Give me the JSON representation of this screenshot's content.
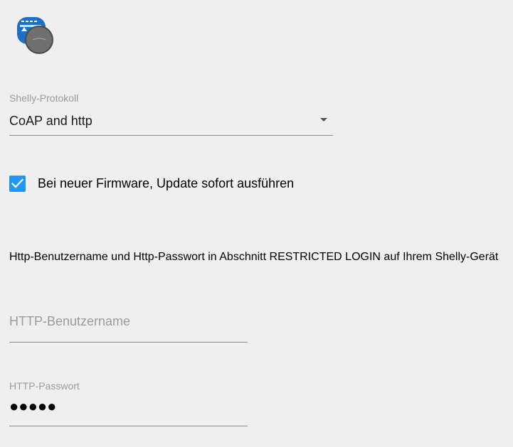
{
  "logo": {
    "icon": "shelly-device-icon",
    "colors": {
      "blue": "#1e6fc6",
      "gray": "#6f6f6f"
    }
  },
  "protocol": {
    "label": "Shelly-Protokoll",
    "value": "CoAP and http"
  },
  "firmware_update": {
    "label": "Bei neuer Firmware, Update sofort ausführen",
    "checked": true,
    "color": "#2196f3"
  },
  "info": {
    "text": "Http-Benutzername und Http-Passwort in Abschnitt RESTRICTED LOGIN auf Ihrem Shelly-Gerät"
  },
  "http_user": {
    "placeholder": "HTTP-Benutzername",
    "value": ""
  },
  "http_password": {
    "label": "HTTP-Passwort",
    "value": "●●●●●"
  }
}
